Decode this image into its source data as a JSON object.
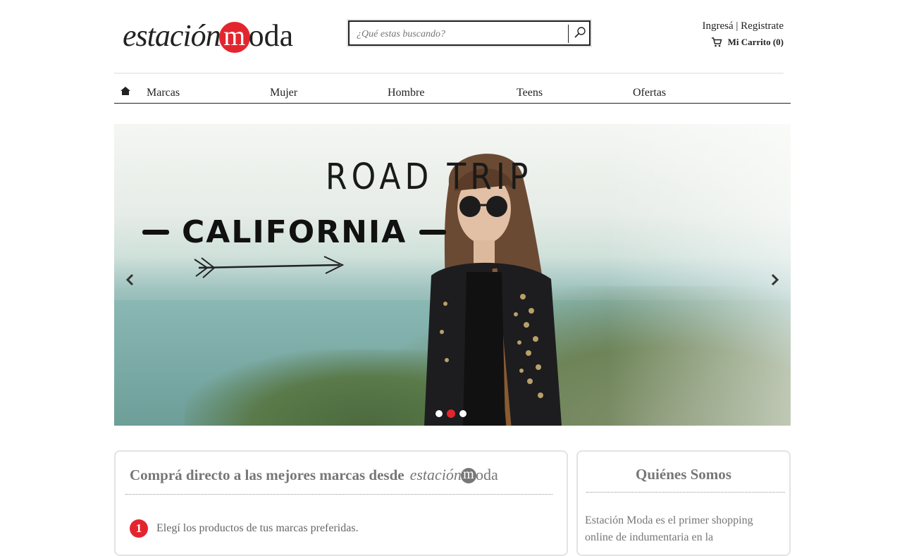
{
  "header": {
    "logo": {
      "part1": "estación",
      "m": "m",
      "part2": "oda"
    },
    "search_placeholder": "¿Qué estas buscando?",
    "login": "Ingresá",
    "separator": "|",
    "register": "Registrate",
    "cart": "Mi Carrito (0)"
  },
  "nav": {
    "items": [
      "Marcas",
      "Mujer",
      "Hombre",
      "Teens",
      "Ofertas"
    ]
  },
  "hero": {
    "line1": "ROAD TRIP",
    "line2": "CALIFORNIA",
    "slides": 3,
    "active_slide": 2
  },
  "info": {
    "title": "Comprá directo a las mejores marcas desde",
    "step1_num": "1",
    "step1_text": "Elegí los productos de tus marcas preferidas."
  },
  "about": {
    "title": "Quiénes Somos",
    "text": "Estación Moda es el primer shopping online de indumentaria en la"
  },
  "colors": {
    "brand_red": "#e3262e",
    "text": "#222222",
    "muted": "#777777"
  }
}
